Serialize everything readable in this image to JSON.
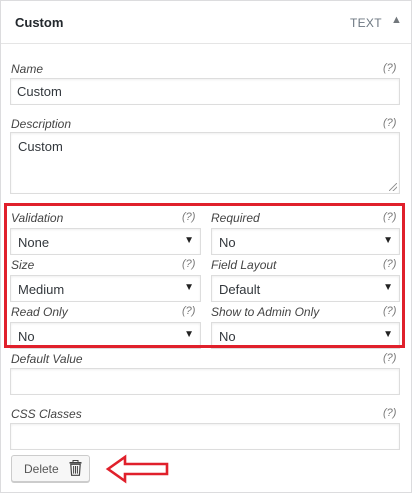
{
  "header": {
    "title": "Custom",
    "type_label": "TEXT",
    "toggle_icon": "triangle-up-icon"
  },
  "help_marker": "(?)",
  "name": {
    "label": "Name",
    "value": "Custom"
  },
  "description": {
    "label": "Description",
    "value": "Custom"
  },
  "validation": {
    "label": "Validation",
    "value": "None"
  },
  "required": {
    "label": "Required",
    "value": "No"
  },
  "size": {
    "label": "Size",
    "value": "Medium"
  },
  "field_layout": {
    "label": "Field Layout",
    "value": "Default"
  },
  "read_only": {
    "label": "Read Only",
    "value": "No"
  },
  "admin_only": {
    "label": "Show to Admin Only",
    "value": "No"
  },
  "default_value": {
    "label": "Default Value",
    "value": ""
  },
  "css_classes": {
    "label": "CSS Classes",
    "value": ""
  },
  "delete_button": {
    "label": "Delete",
    "icon": "trash-icon"
  },
  "annotation": {
    "highlight_color": "#e0202b",
    "arrow_icon": "left-arrow-icon"
  }
}
